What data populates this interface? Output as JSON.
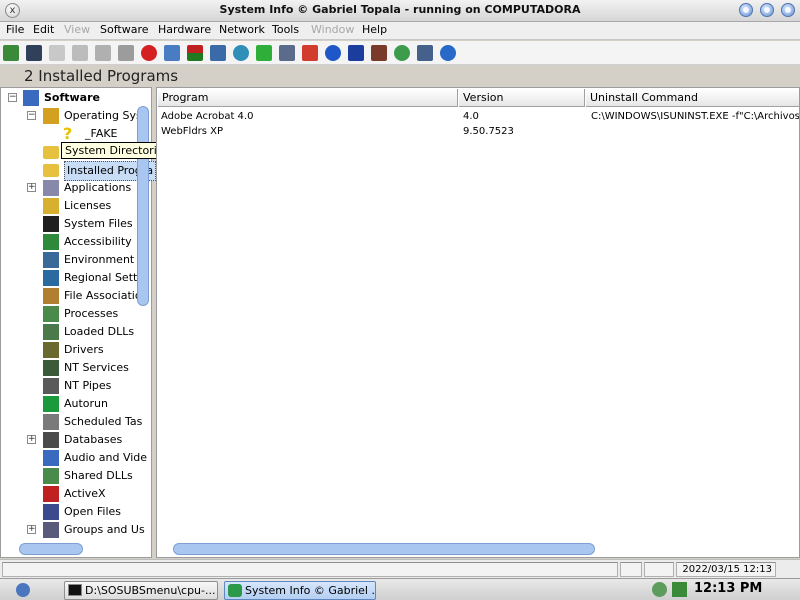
{
  "window": {
    "title": "System Info  © Gabriel Topala - running on COMPUTADORA",
    "close_glyph": "x"
  },
  "menu": [
    "File",
    "Edit",
    "View",
    "Software",
    "Hardware",
    "Network",
    "Tools",
    "Window",
    "Help"
  ],
  "menu_disabled": [
    "View",
    "Window"
  ],
  "toolbar_icons": [
    "exit-icon",
    "save-icon",
    "cut-icon",
    "copy-icon",
    "paste-icon",
    "print-icon",
    "stop-icon",
    "chat-icon",
    "chart-icon",
    "graph-icon",
    "globe-icon",
    "refresh-icon",
    "document-icon",
    "record-icon",
    "browser-icon",
    "shield-icon",
    "building-icon",
    "network-globe-icon",
    "disk-icon",
    "help-icon"
  ],
  "heading": "2 Installed Programs",
  "tree": {
    "root": "Software",
    "items": [
      {
        "label": "Operating Syst",
        "icon": "windows-icon",
        "level": 1,
        "expander": "-"
      },
      {
        "label": "_FAKE",
        "icon": "question-icon",
        "level": 2,
        "expander": ""
      },
      {
        "label": "System Directories",
        "icon": "folder-icon",
        "level": 1,
        "expander": ""
      },
      {
        "label": "Installed Progra",
        "icon": "programs-icon",
        "level": 1,
        "expander": "",
        "selected": true
      },
      {
        "label": "Applications",
        "icon": "applications-icon",
        "level": 1,
        "expander": "+"
      },
      {
        "label": "Licenses",
        "icon": "lock-icon",
        "level": 1,
        "expander": ""
      },
      {
        "label": "System Files",
        "icon": "console-icon",
        "level": 1,
        "expander": ""
      },
      {
        "label": "Accessibility",
        "icon": "accessibility-icon",
        "level": 1,
        "expander": ""
      },
      {
        "label": "Environment",
        "icon": "environment-icon",
        "level": 1,
        "expander": ""
      },
      {
        "label": "Regional Settin",
        "icon": "regional-globe-icon",
        "level": 1,
        "expander": ""
      },
      {
        "label": "File Associatio",
        "icon": "file-association-icon",
        "level": 1,
        "expander": ""
      },
      {
        "label": "Processes",
        "icon": "processes-icon",
        "level": 1,
        "expander": ""
      },
      {
        "label": "Loaded DLLs",
        "icon": "dll-icon",
        "level": 1,
        "expander": ""
      },
      {
        "label": "Drivers",
        "icon": "drivers-icon",
        "level": 1,
        "expander": ""
      },
      {
        "label": "NT Services",
        "icon": "services-icon",
        "level": 1,
        "expander": ""
      },
      {
        "label": "NT Pipes",
        "icon": "pipes-icon",
        "level": 1,
        "expander": ""
      },
      {
        "label": "Autorun",
        "icon": "autorun-icon",
        "level": 1,
        "expander": ""
      },
      {
        "label": "Scheduled Tas",
        "icon": "scheduled-tasks-icon",
        "level": 1,
        "expander": ""
      },
      {
        "label": "Databases",
        "icon": "databases-icon",
        "level": 1,
        "expander": "+"
      },
      {
        "label": "Audio and Vide",
        "icon": "audio-video-icon",
        "level": 1,
        "expander": ""
      },
      {
        "label": "Shared DLLs",
        "icon": "shared-dll-icon",
        "level": 1,
        "expander": ""
      },
      {
        "label": "ActiveX",
        "icon": "activex-icon",
        "level": 1,
        "expander": ""
      },
      {
        "label": "Open Files",
        "icon": "open-files-icon",
        "level": 1,
        "expander": ""
      },
      {
        "label": "Groups and Us",
        "icon": "groups-icon",
        "level": 1,
        "expander": "+"
      }
    ]
  },
  "tooltip": "System Directories",
  "table": {
    "columns": [
      "Program",
      "Version",
      "Uninstall Command"
    ],
    "rows": [
      [
        "Adobe Acrobat 4.0",
        "4.0",
        "C:\\WINDOWS\\ISUNINST.EXE -f\"C:\\Archivos"
      ],
      [
        "WebFldrs XP",
        "9.50.7523",
        ""
      ]
    ]
  },
  "statusbar": {
    "datetime": "2022/03/15 12:13"
  },
  "taskbar": {
    "tasks": [
      {
        "label": "D:\\SOSUBSmenu\\cpu-...",
        "icon": "console-icon",
        "active": false
      },
      {
        "label": "System Info  © Gabriel ...",
        "icon": "system-info-icon",
        "active": true
      }
    ],
    "clock": "12:13 PM"
  },
  "colors": {
    "selection": "#c8dcf6",
    "scroll_thumb": "#a8c6ef",
    "tooltip_bg": "#ffffe1"
  }
}
